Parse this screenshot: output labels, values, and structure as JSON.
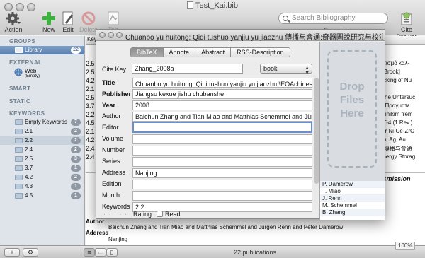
{
  "window": {
    "title": "Test_Kai.bib",
    "toolbar": {
      "action": "Action",
      "new": "New",
      "edit": "Edit",
      "delete": "Delete",
      "tex_preview": "TeX Preview",
      "search_placeholder": "Search Bibliography",
      "search_label": "Search",
      "cite_drawer": "Cite Drawer"
    }
  },
  "sidebar": {
    "groups_header": "GROUPS",
    "library": {
      "label": "Library",
      "count": "22"
    },
    "external_header": "EXTERNAL",
    "web": {
      "label": "Web",
      "sub": "(Empty)"
    },
    "smart_header": "SMART",
    "static_header": "STATIC",
    "keywords_header": "KEYWORDS",
    "keywords": [
      {
        "label": "Empty Keywords",
        "count": "7"
      },
      {
        "label": "2.1",
        "count": "2"
      },
      {
        "label": "2.2",
        "count": "2"
      },
      {
        "label": "2.4",
        "count": "2"
      },
      {
        "label": "2.5",
        "count": "3"
      },
      {
        "label": "3.7",
        "count": "1"
      },
      {
        "label": "4.2",
        "count": "2"
      },
      {
        "label": "4.3",
        "count": "1"
      },
      {
        "label": "4.5",
        "count": "1"
      }
    ]
  },
  "pubtable": {
    "header_key": "Key",
    "rows": [
      {
        "num": "2.5",
        "text": "υπισμό καλ-"
      },
      {
        "num": "2.5",
        "text": "n Brook]"
      },
      {
        "num": "4.2",
        "text": "fficking of Nu"
      },
      {
        "num": "2.1",
        "text": ""
      },
      {
        "num": "2.5",
        "text": "sche Untersuc"
      },
      {
        "num": "3.7",
        "text": "ω Πραγματε"
      },
      {
        "num": "2.2",
        "text": "upinikim frem"
      },
      {
        "num": "4.5",
        "text": "NT-4 (1.Rev.)"
      },
      {
        "num": "2.1",
        "text": "ver Ni-Ce-ZrO"
      },
      {
        "num": "4.2",
        "text": "Cu, Ag, Au"
      },
      {
        "num": "2.4",
        "text": "u 傳播与會通"
      },
      {
        "num": "2.4",
        "text": "Energy Storag"
      }
    ]
  },
  "preview": {
    "heading_suffix": "nsmission",
    "author_label": "Author",
    "authors": "Baichun Zhang and Tian Miao and Matthias Schemmel and Jürgen Renn and Peter Damerow",
    "address_label": "Address",
    "address": "Nanjing"
  },
  "status": {
    "count": "22 publications",
    "zoom": "100%"
  },
  "editor": {
    "title": "Chuanbo yu huitong: Qiqi tushuo yanjiu yu jiaozhu 傳播与會通:奇器圖說研究与校注 [Tra...",
    "tabs": [
      "BibTeX",
      "Annote",
      "Abstract",
      "RSS-Description"
    ],
    "active_tab": "BibTeX",
    "cite_key_label": "Cite Key",
    "cite_key": "Zhang_2008a",
    "type": "book",
    "fields": [
      {
        "label": "Title",
        "value": "Chuanbo yu huitong: Qiqi tushuo yanjiu yu jiaozhu \\EOAchinese{傳播与會通",
        "bold": true
      },
      {
        "label": "Publisher",
        "value": "Jiangsu kexue jishu chubanshe",
        "bold": true
      },
      {
        "label": "Year",
        "value": "2008",
        "bold": true
      },
      {
        "label": "Author",
        "value": "Baichun Zhang and Tian Miao and Matthias Schemmel and Jürgen Renn",
        "bold": false
      },
      {
        "label": "Editor",
        "value": "",
        "bold": false
      },
      {
        "label": "Volume",
        "value": "",
        "bold": false
      },
      {
        "label": "Number",
        "value": "",
        "bold": false
      },
      {
        "label": "Series",
        "value": "",
        "bold": false
      },
      {
        "label": "Address",
        "value": "Nanjing",
        "bold": false
      },
      {
        "label": "Edition",
        "value": "",
        "bold": false
      },
      {
        "label": "Month",
        "value": "",
        "bold": false
      },
      {
        "label": "Keywords",
        "value": "2.2",
        "bold": false
      }
    ],
    "rating_label": "Rating",
    "rating": 0,
    "read_label": "Read",
    "drop_text": [
      "Drop",
      "Files",
      "Here"
    ],
    "authors": [
      "P. Damerow",
      "T. Miao",
      "J. Renn",
      "M. Schemmel",
      "B. Zhang"
    ]
  }
}
